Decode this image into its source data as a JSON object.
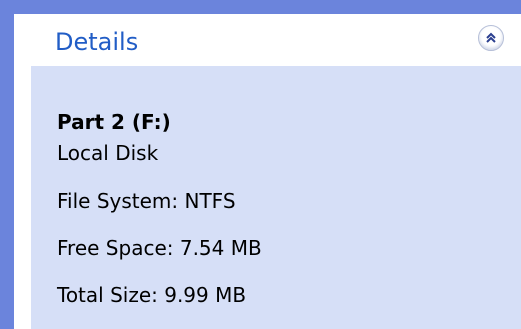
{
  "panel": {
    "title": "Details",
    "collapse_icon": "double-chevron-up-icon"
  },
  "drive": {
    "name": "Part 2 (F:)",
    "type": "Local Disk",
    "file_system_label": "File System: NTFS",
    "free_space_label": "Free Space: 7.54 MB",
    "total_size_label": "Total Size: 9.99 MB"
  },
  "colors": {
    "pane_blue": "#6b84dc",
    "header_text": "#215dc6",
    "body_background": "#d6dff7"
  }
}
